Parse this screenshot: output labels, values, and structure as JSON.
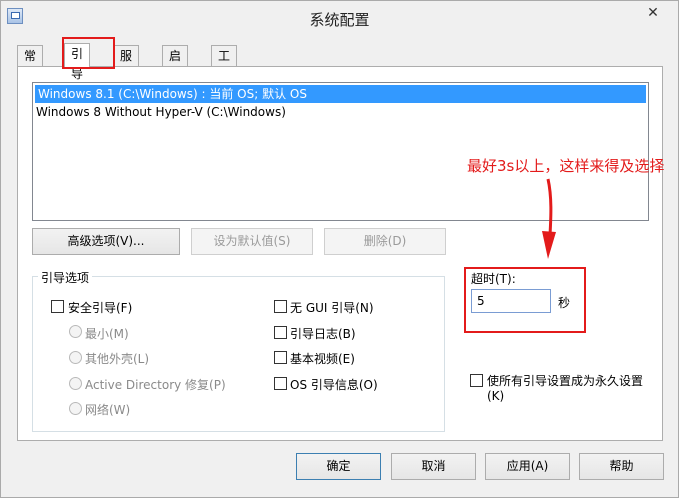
{
  "window": {
    "title": "系统配置",
    "close_glyph": "✕"
  },
  "tabs": [
    {
      "label": "常规"
    },
    {
      "label": "引导"
    },
    {
      "label": "服务"
    },
    {
      "label": "启动"
    },
    {
      "label": "工具"
    }
  ],
  "os_list": [
    "Windows 8.1 (C:\\Windows) : 当前 OS; 默认 OS",
    "Windows 8 Without Hyper-V (C:\\Windows)"
  ],
  "annotation": "最好3s以上，这样来得及选择",
  "buttons": {
    "advanced": "高级选项(V)...",
    "set_default": "设为默认值(S)",
    "delete": "删除(D)",
    "ok": "确定",
    "cancel": "取消",
    "apply": "应用(A)",
    "help": "帮助"
  },
  "boot_options": {
    "group_label": "引导选项",
    "safe_boot": "安全引导(F)",
    "minimal": "最小(M)",
    "alternate_shell": "其他外壳(L)",
    "active_directory": "Active Directory 修复(P)",
    "network": "网络(W)",
    "no_gui": "无 GUI 引导(N)",
    "boot_log": "引导日志(B)",
    "base_video": "基本视频(E)",
    "os_info": "OS 引导信息(O)"
  },
  "timeout": {
    "label": "超时(T):",
    "value": "5",
    "unit": "秒"
  },
  "permanent": {
    "line1": "使所有引导设置成为永久设置",
    "line2": "(K)"
  },
  "colors": {
    "highlight": "#e31b1b",
    "selection": "#3399ff"
  }
}
